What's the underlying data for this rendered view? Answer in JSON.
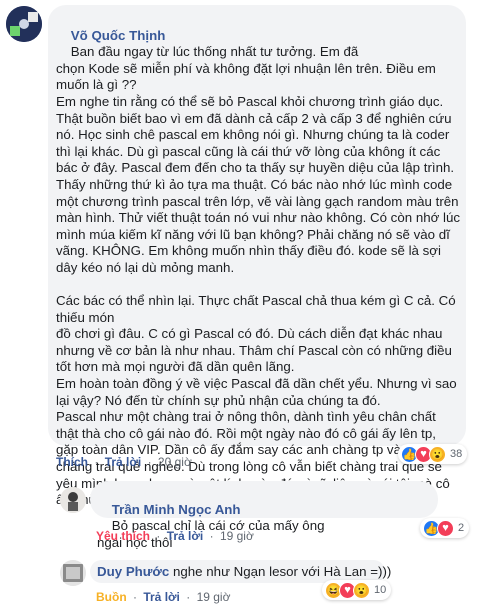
{
  "comments": [
    {
      "author": "Võ Quốc Thịnh",
      "text": "Ban đầu ngay từ lúc thống nhất tư tưởng. Em đã\nchọn Kode sẽ miễn phí và không đặt lợi nhuận lên trên. Điều em\nmuốn là gì ??\nEm nghe tin rằng có thể sẽ bỏ Pascal khỏi chương trình giáo dục.\nThật buồn biết bao vì em đã dành cả cấp 2 và cấp 3 để nghiên cứu\nnó. Học sinh chê pascal em không nói gì. Nhưng chúng ta là coder\nthì lại khác. Dù gì pascal cũng là cái thứ vỡ lòng của không ít các\nbác ở đây. Pascal đem đến cho ta thấy sự huyền diệu của lập trình.\nThấy những thứ kì ảo tựa ma thuật. Có bác nào nhớ lúc mình code\nmột chương trình pascal trên lớp, vẽ vài làng gạch random màu trên\nmàn hình. Thử viết thuật toán nó vui như nào không. Có còn nhớ lúc\nmình múa kiếm kĩ năng với lũ bạn không? Phải chăng nó sẽ vào dĩ\nvãng. KHÔNG. Em không muốn nhìn thấy điều đó. kode sẽ là sợi\ndây kéo nó lại dù mỏng manh.\n\nCác bác có thể nhìn lại. Thực chất Pascal chả thua kém gì C cả. Có thiếu món\nđồ chơi gì đâu. C có gì Pascal có đó. Dù cách diễn đạt khác nhau\nnhưng về cơ bản là như nhau. Thâm chí Pascal còn có những điều\ntốt hơn mà mọi người đã dần quên lãng.\nEm hoàn toàn đồng ý về việc Pascal đã dần chết yểu. Nhưng vì sao\nlại vậy? Nó đến từ chính sự phủ nhận của chúng ta đó.\nPascal như một chàng trai ở nông thôn, dành tình yêu chân chất\nthật thà cho cô gái nào đó. Rồi một ngày nào đó cô gái ấy lên tp,\ngặp toàn dân VIP. Dần cô ấy đắm say các anh chàng tp và bỏ quên\nchàng trai quê nghèo. Dù trong lòng cô vẫn biết chàng trai quê sẽ\nyêu mình hơn nhưng vì một lí do nào đó, vì sĩ diện, vì cái tôi mà cô\nấy phủ nhận. Pascal cũng thế ấy.",
      "reaction_count": "38",
      "like": "Thích",
      "reply": "Trả lời",
      "time": "20 giờ"
    },
    {
      "author": "Trần Minh Ngọc Anh",
      "text": "Bỏ pascal chỉ là cái cớ của mấy ông\nngai học thôi",
      "reaction_count": "2",
      "like": "Yêu thích",
      "reply": "Trả lời",
      "time": "19 giờ"
    },
    {
      "author": "Duy Phước",
      "text": "nghe như Ngạn lesor với Hà Lan =)))",
      "reaction_count": "10",
      "like": "Buồn",
      "reply": "Trả lời",
      "time": "19 giờ"
    }
  ],
  "separator": "·",
  "colors": {
    "like_blue": "#2078f4",
    "love_red": "#f33e58",
    "haha_yellow": "#f7b125",
    "sad_yellow": "#f7b928",
    "link": "#385898"
  }
}
